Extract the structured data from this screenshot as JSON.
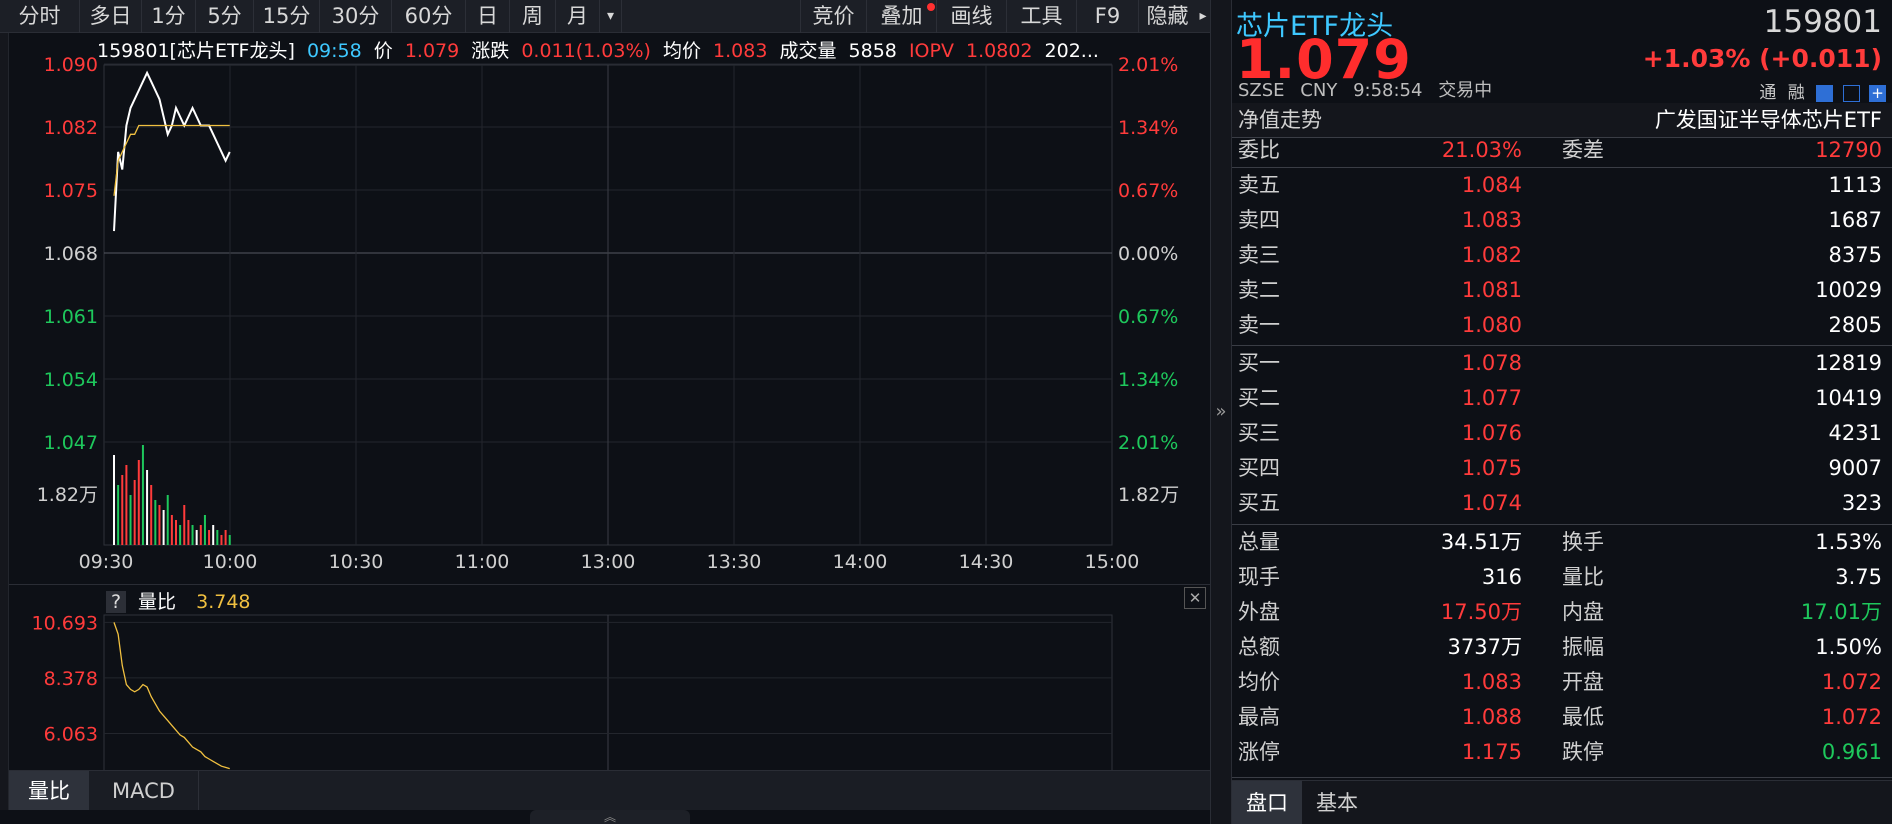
{
  "toolbar": {
    "left": [
      "分时",
      "多日",
      "1分",
      "5分",
      "15分",
      "30分",
      "60分",
      "日",
      "周",
      "月"
    ],
    "more_arrow": "▾",
    "right": [
      "竞价",
      "叠加",
      "画线",
      "工具",
      "F9",
      "隐藏"
    ],
    "right_more": "▸"
  },
  "info": {
    "name": "159801[芯片ETF龙头]",
    "time": "09:58",
    "price_label": "价",
    "price": "1.079",
    "change_label": "涨跌",
    "change": "0.011(1.03%)",
    "avg_label": "均价",
    "avg": "1.083",
    "vol_label": "成交量",
    "vol": "5858",
    "iopv_label": "IOPV",
    "iopv": "1.0802",
    "trail": "202..."
  },
  "chart_data": [
    {
      "type": "line",
      "title": "159801[芯片ETF龙头]",
      "x_ticks": [
        "09:30",
        "10:00",
        "10:30",
        "11:00",
        "13:00",
        "13:30",
        "14:00",
        "14:30",
        "15:00"
      ],
      "y_left_ticks": [
        "1.090",
        "1.082",
        "1.075",
        "1.068",
        "1.061",
        "1.054",
        "1.047"
      ],
      "y_right_ticks": [
        "2.01%",
        "1.34%",
        "0.67%",
        "0.00%",
        "0.67%",
        "1.34%",
        "2.01%"
      ],
      "vol_tick": "1.82万",
      "ylim": [
        1.047,
        1.09
      ],
      "series": [
        {
          "name": "价",
          "color": "#ffffff",
          "x": [
            0,
            1,
            2,
            3,
            4,
            5,
            6,
            7,
            8,
            9,
            10,
            11,
            12,
            13,
            14,
            15,
            16,
            17,
            18,
            19,
            20,
            21,
            22,
            23,
            24,
            25,
            26,
            27,
            28
          ],
          "values": [
            1.071,
            1.08,
            1.078,
            1.083,
            1.085,
            1.086,
            1.087,
            1.088,
            1.089,
            1.088,
            1.087,
            1.086,
            1.084,
            1.082,
            1.083,
            1.085,
            1.084,
            1.083,
            1.084,
            1.085,
            1.084,
            1.083,
            1.083,
            1.083,
            1.082,
            1.081,
            1.08,
            1.079,
            1.08
          ]
        },
        {
          "name": "均价",
          "color": "#f0c040",
          "x": [
            0,
            1,
            2,
            3,
            4,
            5,
            6,
            7,
            8,
            9,
            10,
            11,
            12,
            13,
            14,
            15,
            16,
            17,
            18,
            19,
            20,
            21,
            22,
            23,
            24,
            25,
            26,
            27,
            28
          ],
          "values": [
            1.075,
            1.079,
            1.08,
            1.081,
            1.082,
            1.082,
            1.083,
            1.083,
            1.083,
            1.083,
            1.083,
            1.083,
            1.083,
            1.083,
            1.083,
            1.083,
            1.083,
            1.083,
            1.083,
            1.083,
            1.083,
            1.083,
            1.083,
            1.083,
            1.083,
            1.083,
            1.083,
            1.083,
            1.083
          ]
        }
      ],
      "volume": [
        18,
        12,
        14,
        16,
        10,
        13,
        17,
        20,
        15,
        12,
        9,
        8,
        7,
        10,
        6,
        5,
        4,
        8,
        5,
        4,
        3,
        4,
        6,
        3,
        4,
        3,
        2,
        3,
        2
      ]
    },
    {
      "type": "line",
      "title": "量比",
      "y_ticks": [
        "10.693",
        "8.378",
        "6.063"
      ],
      "ylim": [
        4.5,
        11.0
      ],
      "series": [
        {
          "name": "量比",
          "color": "#f0c040",
          "x": [
            0,
            1,
            2,
            3,
            4,
            5,
            6,
            7,
            8,
            9,
            10,
            11,
            12,
            13,
            14,
            15,
            16,
            17,
            18,
            19,
            20,
            21,
            22,
            23,
            24,
            25,
            26,
            27,
            28
          ],
          "values": [
            10.693,
            10.2,
            8.9,
            8.1,
            7.9,
            7.8,
            7.9,
            8.1,
            8.0,
            7.6,
            7.3,
            7.0,
            6.8,
            6.6,
            6.4,
            6.2,
            6.0,
            5.9,
            5.7,
            5.5,
            5.4,
            5.3,
            5.1,
            5.0,
            4.9,
            4.8,
            4.7,
            4.65,
            4.6
          ]
        }
      ]
    }
  ],
  "sub": {
    "help": "?",
    "label": "量比",
    "value": "3.748",
    "close": "✕"
  },
  "bottom_tabs": [
    "量比",
    "MACD"
  ],
  "quote": {
    "name": "芯片ETF龙头",
    "code": "159801",
    "price": "1.079",
    "change": "+1.03% (+0.011)",
    "exchange": "SZSE",
    "currency": "CNY",
    "time": "9:58:54",
    "status": "交易中",
    "icons_text": [
      "通",
      "融"
    ],
    "nav_label": "净值走势",
    "fund_name": "广发国证半导体芯片ETF",
    "weibi_label": "委比",
    "weibi": "21.03%",
    "weicha_label": "委差",
    "weicha": "12790",
    "asks": [
      {
        "label": "卖五",
        "price": "1.084",
        "vol": "1113"
      },
      {
        "label": "卖四",
        "price": "1.083",
        "vol": "1687"
      },
      {
        "label": "卖三",
        "price": "1.082",
        "vol": "8375"
      },
      {
        "label": "卖二",
        "price": "1.081",
        "vol": "10029"
      },
      {
        "label": "卖一",
        "price": "1.080",
        "vol": "2805"
      }
    ],
    "bids": [
      {
        "label": "买一",
        "price": "1.078",
        "vol": "12819"
      },
      {
        "label": "买二",
        "price": "1.077",
        "vol": "10419"
      },
      {
        "label": "买三",
        "price": "1.076",
        "vol": "4231"
      },
      {
        "label": "买四",
        "price": "1.075",
        "vol": "9007"
      },
      {
        "label": "买五",
        "price": "1.074",
        "vol": "323"
      }
    ],
    "stats": [
      {
        "l1": "总量",
        "v1": "34.51万",
        "c1": "white",
        "l2": "换手",
        "v2": "1.53%",
        "c2": "white"
      },
      {
        "l1": "现手",
        "v1": "316",
        "c1": "white",
        "l2": "量比",
        "v2": "3.75",
        "c2": "white"
      },
      {
        "l1": "外盘",
        "v1": "17.50万",
        "c1": "red",
        "l2": "内盘",
        "v2": "17.01万",
        "c2": "green"
      },
      {
        "l1": "总额",
        "v1": "3737万",
        "c1": "white",
        "l2": "振幅",
        "v2": "1.50%",
        "c2": "white"
      },
      {
        "l1": "均价",
        "v1": "1.083",
        "c1": "red",
        "l2": "开盘",
        "v2": "1.072",
        "c2": "red"
      },
      {
        "l1": "最高",
        "v1": "1.088",
        "c1": "red",
        "l2": "最低",
        "v2": "1.072",
        "c2": "red"
      },
      {
        "l1": "涨停",
        "v1": "1.175",
        "c1": "red",
        "l2": "跌停",
        "v2": "0.961",
        "c2": "green"
      }
    ],
    "tabs": [
      "盘口",
      "基本"
    ]
  },
  "collapse_glyph": "»",
  "expand_glyph": "︽"
}
